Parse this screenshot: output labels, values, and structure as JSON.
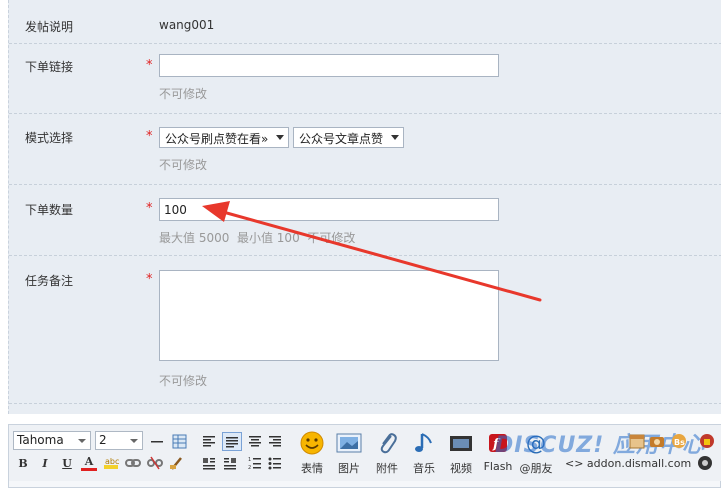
{
  "form": {
    "post_note": {
      "label": "发帖说明",
      "value": "wang001"
    },
    "order_link": {
      "label": "下单链接",
      "required_mark": "*",
      "value": "",
      "hint": "不可修改"
    },
    "mode_select": {
      "label": "模式选择",
      "required_mark": "*",
      "select1": "公众号刷点赞在看»",
      "select2": "公众号文章点赞",
      "hint": "不可修改"
    },
    "order_qty": {
      "label": "下单数量",
      "required_mark": "*",
      "value": "100",
      "hint": "最大值 5000  最小值 100  不可修改"
    },
    "task_note": {
      "label": "任务备注",
      "required_mark": "*",
      "value": "",
      "hint": "不可修改"
    }
  },
  "editor": {
    "font_family": "Tahoma",
    "font_size": "2",
    "format_buttons": {
      "bold": "B",
      "italic": "I",
      "underline": "U",
      "color": "A"
    },
    "tools": [
      {
        "name": "emoji",
        "label": "表情"
      },
      {
        "name": "image",
        "label": "图片"
      },
      {
        "name": "attachment",
        "label": "附件"
      },
      {
        "name": "music",
        "label": "音乐"
      },
      {
        "name": "video",
        "label": "视频"
      },
      {
        "name": "flash",
        "label": "Flash"
      },
      {
        "name": "mention",
        "label": "@朋友"
      }
    ],
    "right_text": "<> addon.dismall.com",
    "watermark": "DISCUZ! 应用中心",
    "watermark_sub": "addon.dismall.com"
  },
  "colors": {
    "required": "#e02020",
    "annotation_arrow": "#e8382c",
    "panel_bg": "#e8edf3"
  }
}
